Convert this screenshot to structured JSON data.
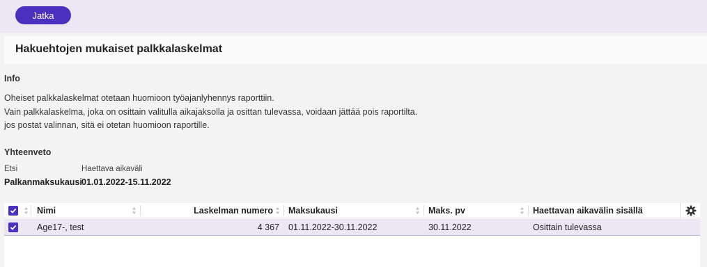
{
  "toolbar": {
    "continue_label": "Jatka"
  },
  "page": {
    "title": "Hakuehtojen mukaiset palkkalaskelmat"
  },
  "info": {
    "heading": "Info",
    "lines": [
      "Oheiset palkkalaskelmat otetaan huomioon työajanlyhennys raporttiin.",
      "Vain palkkalaskelma, joka on osittain valitulla aikajaksolla ja osittan tulevassa, voidaan jättää pois raportilta.",
      "jos postat valinnan, sitä ei otetan huomioon raportille."
    ]
  },
  "summary": {
    "heading": "Yhteenveto",
    "search_label": "Etsi",
    "search_value": "Palkanmaksukausi",
    "period_label": "Haettava aikaväli",
    "period_value": "01.01.2022-15.11.2022"
  },
  "table": {
    "columns": [
      "Nimi",
      "Laskelman numero",
      "Maksukausi",
      "Maks. pv",
      "Haettavan aikavälin sisällä"
    ],
    "rows": [
      {
        "checked": true,
        "name": "Age17-, test",
        "number": "4 367",
        "period": "01.11.2022-30.11.2022",
        "payday": "30.11.2022",
        "within": "Osittain tulevassa"
      }
    ]
  },
  "colors": {
    "accent": "#4b2fbf",
    "selected_row": "#ece6f5",
    "top_bar": "#ece6f5"
  },
  "icons": {
    "settings": "gear-icon",
    "sort": "sort-icon",
    "check": "check-icon"
  }
}
